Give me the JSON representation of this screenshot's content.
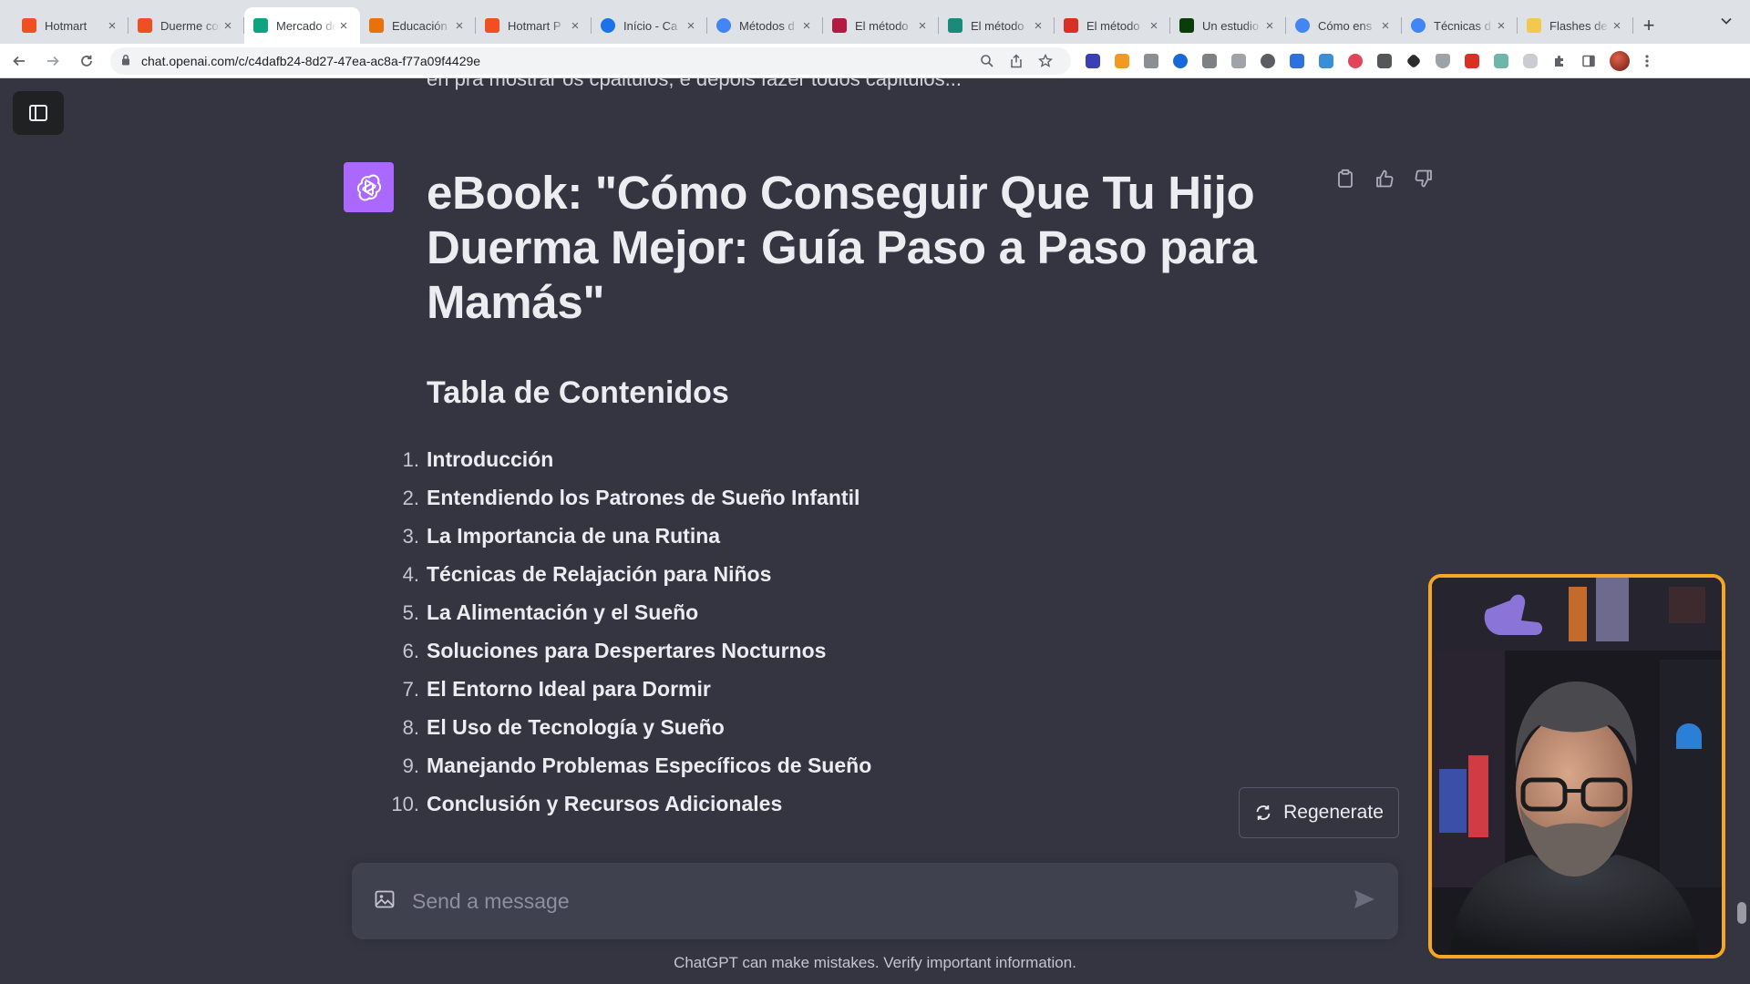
{
  "browser": {
    "tabs": [
      {
        "label": "Hotmart",
        "favicon": "hotmart-flame-icon",
        "color": "#f04e23",
        "active": false
      },
      {
        "label": "Duerme con",
        "favicon": "hotmart-flame-icon",
        "color": "#f04e23",
        "active": false
      },
      {
        "label": "Mercado de",
        "favicon": "chatgpt-icon",
        "color": "#10a37f",
        "active": true
      },
      {
        "label": "Educación",
        "favicon": "trend-icon",
        "color": "#e8710a",
        "active": false
      },
      {
        "label": "Hotmart P",
        "favicon": "hotmart-flame-icon",
        "color": "#f04e23",
        "active": false
      },
      {
        "label": "Início - Ca",
        "favicon": "globe-icon",
        "color": "#1a73e8",
        "active": false
      },
      {
        "label": "Métodos d",
        "favicon": "google-icon",
        "color": "#4285f4",
        "active": false
      },
      {
        "label": "El método",
        "favicon": "flag-icon",
        "color": "#b31942",
        "active": false
      },
      {
        "label": "El método",
        "favicon": "grid-icon",
        "color": "#1a8a7a",
        "active": false
      },
      {
        "label": "El método",
        "favicon": "red-square-icon",
        "color": "#d93025",
        "active": false
      },
      {
        "label": "Un estudio",
        "favicon": "green-square-icon",
        "color": "#0b3d0b",
        "active": false
      },
      {
        "label": "Cómo ens",
        "favicon": "google-icon",
        "color": "#4285f4",
        "active": false
      },
      {
        "label": "Técnicas d",
        "favicon": "google-icon",
        "color": "#4285f4",
        "active": false
      },
      {
        "label": "Flashes de",
        "favicon": "star-icon",
        "color": "#f2c94c",
        "active": false
      }
    ],
    "new_tab_symbol": "+",
    "url": "chat.openai.com/c/c4dafb24-8d27-47ea-ac8a-f77a09f4429e"
  },
  "chat": {
    "previous_message": "en pra mostrar os cpaitulos, e depois fazer todos capitulos...",
    "ebook_title": "eBook: \"Cómo Conseguir Que Tu Hijo Duerma Mejor: Guía Paso a Paso para Mamás\"",
    "toc_heading": "Tabla de Contenidos",
    "toc": [
      {
        "num": "1.",
        "text": "Introducción"
      },
      {
        "num": "2.",
        "text": "Entendiendo los Patrones de Sueño Infantil"
      },
      {
        "num": "3.",
        "text": "La Importancia de una Rutina"
      },
      {
        "num": "4.",
        "text": "Técnicas de Relajación para Niños"
      },
      {
        "num": "5.",
        "text": "La Alimentación y el Sueño"
      },
      {
        "num": "6.",
        "text": "Soluciones para Despertares Nocturnos"
      },
      {
        "num": "7.",
        "text": "El Entorno Ideal para Dormir"
      },
      {
        "num": "8.",
        "text": "El Uso de Tecnología y Sueño"
      },
      {
        "num": "9.",
        "text": "Manejando Problemas Específicos de Sueño"
      },
      {
        "num": "10.",
        "text": "Conclusión y Recursos Adicionales"
      }
    ],
    "regenerate_label": "Regenerate",
    "input_placeholder": "Send a message",
    "disclaimer": "ChatGPT can make mistakes. Verify important information."
  },
  "colors": {
    "page_bg": "#343541",
    "input_bg": "#40414f",
    "avatar_bg": "#ab68ff",
    "webcam_border": "#f5a623"
  }
}
